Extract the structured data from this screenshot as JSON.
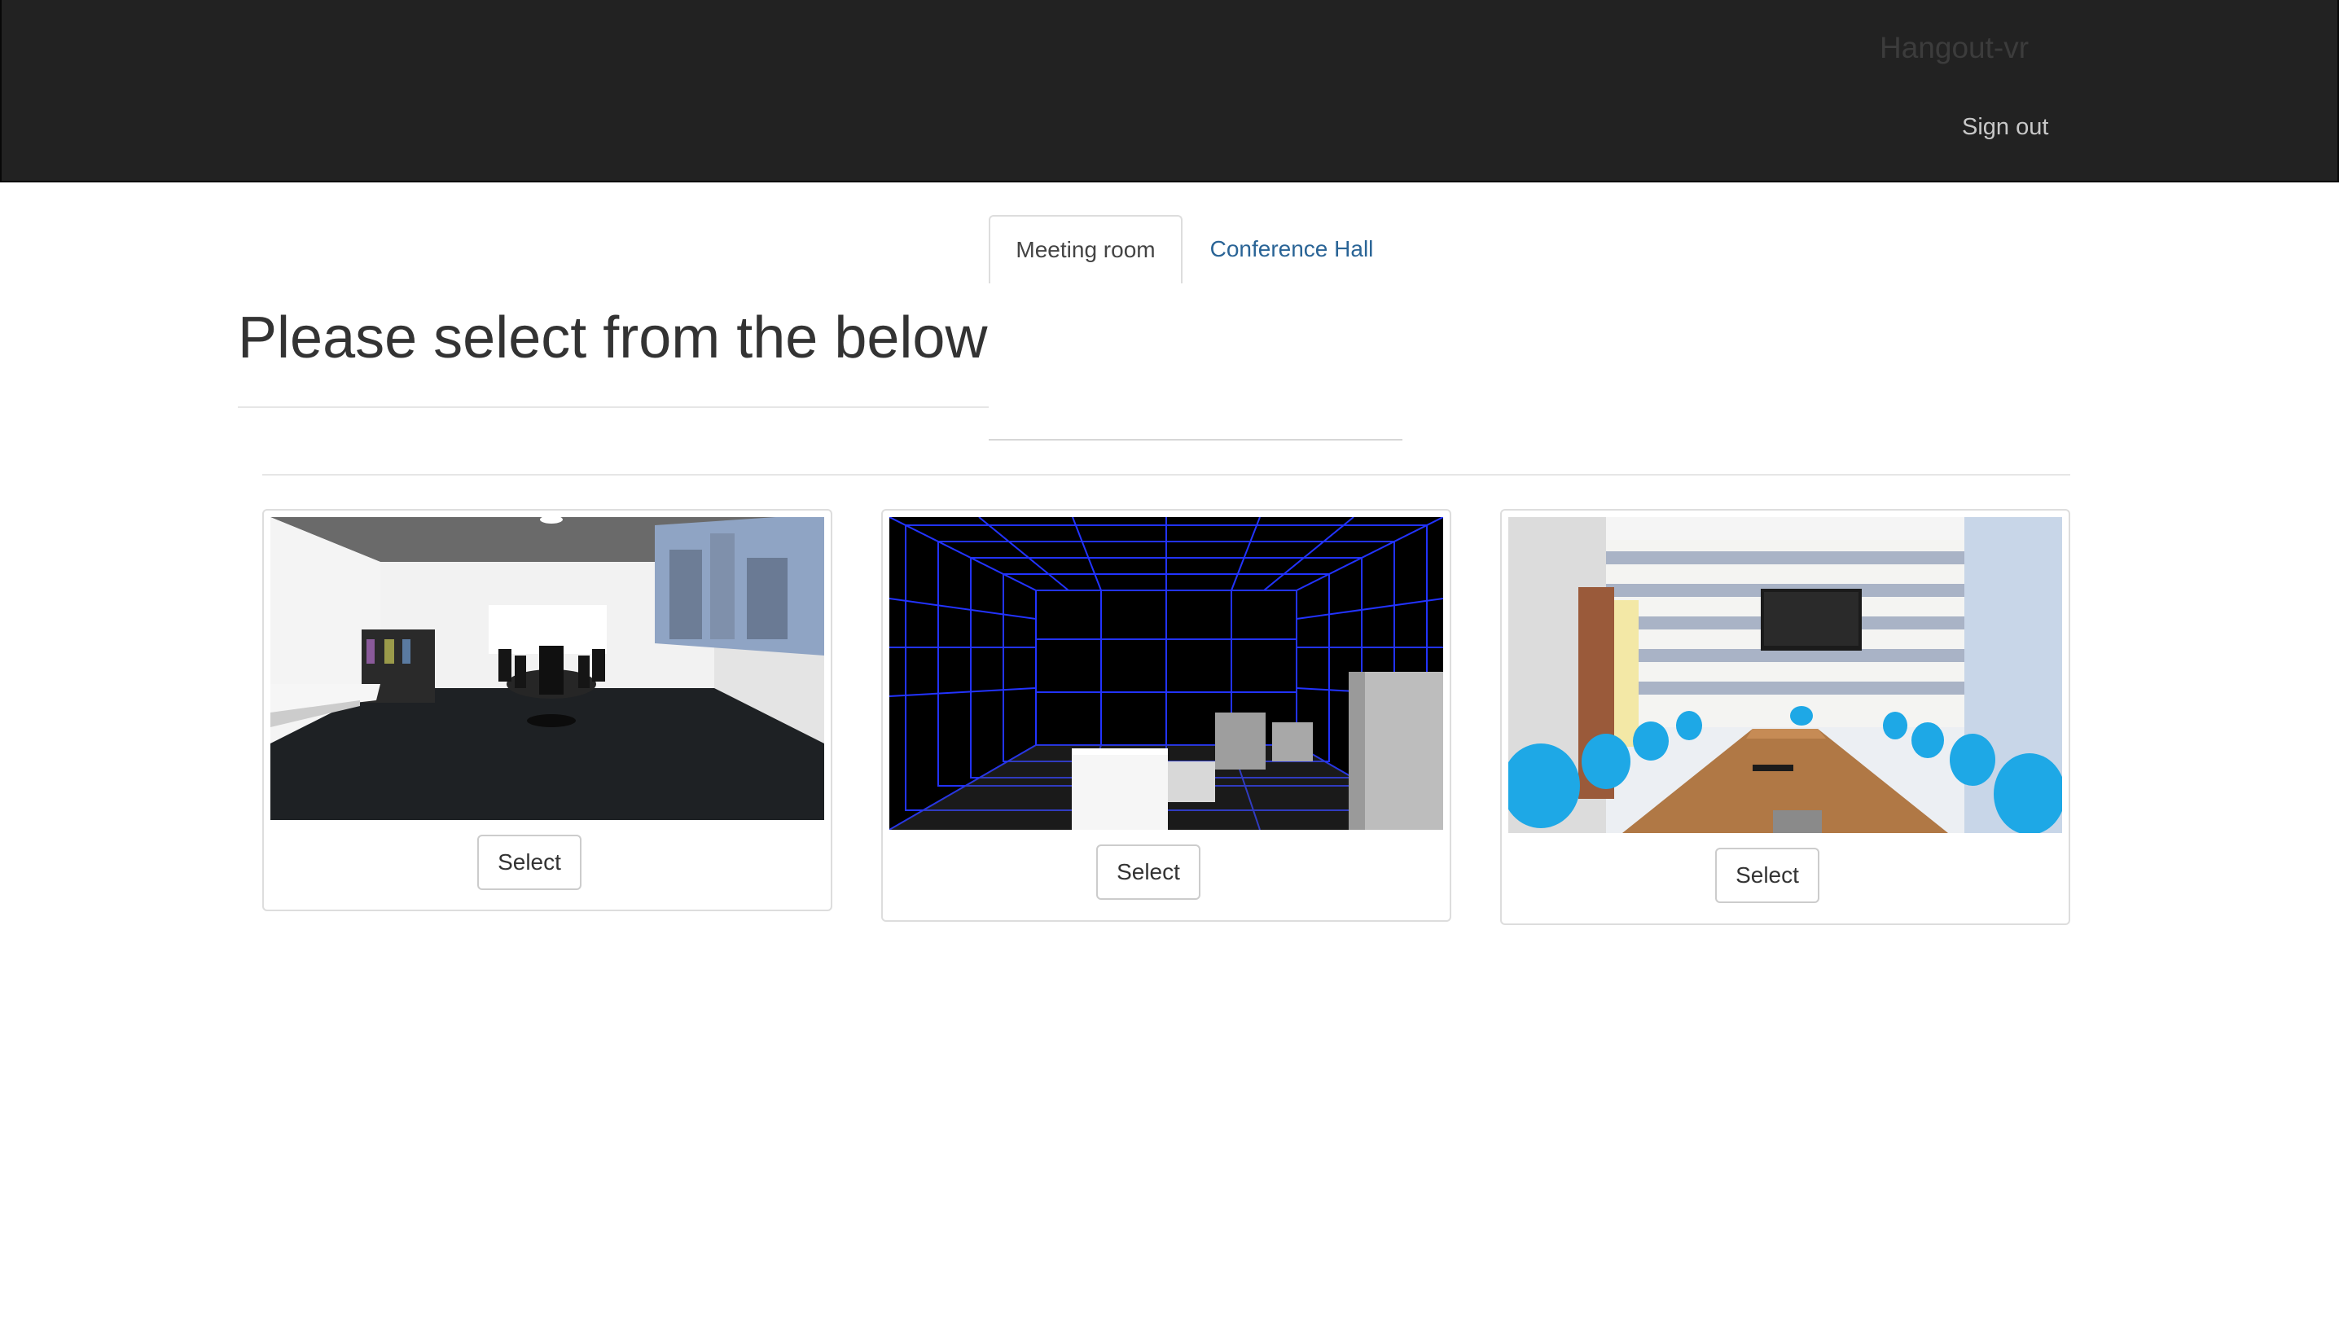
{
  "navbar": {
    "brand": "Hangout-vr",
    "sign_out_label": "Sign out"
  },
  "tabs": [
    {
      "label": "Meeting room",
      "active": true
    },
    {
      "label": "Conference Hall",
      "active": false
    }
  ],
  "heading": "Please select from the below",
  "rooms": [
    {
      "image": "3d-meeting-room-render",
      "select_label": "Select"
    },
    {
      "image": "blue-grid-wireframe-room",
      "select_label": "Select"
    },
    {
      "image": "conference-room-photo",
      "select_label": "Select"
    }
  ],
  "colors": {
    "navbar": "#222222",
    "link": "#2a6496",
    "grid": "#2233ff",
    "chair": "#1ea8e6"
  }
}
